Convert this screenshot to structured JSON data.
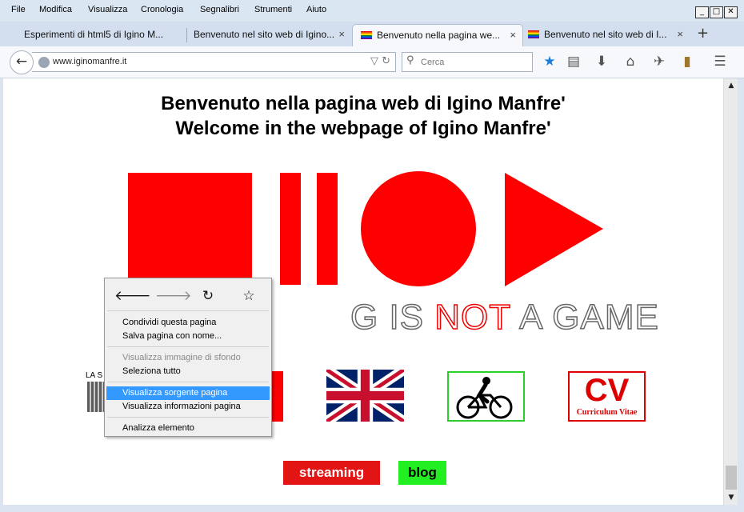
{
  "menubar": {
    "items": [
      "File",
      "Modifica",
      "Visualizza",
      "Cronologia",
      "Segnalibri",
      "Strumenti",
      "Aiuto"
    ],
    "window_buttons": {
      "minimize": "_",
      "maximize": "□",
      "close": "✕"
    }
  },
  "tabs": [
    {
      "label": "Esperimenti di html5 di Igino M...",
      "active": false,
      "has_flag": false
    },
    {
      "label": "Benvenuto nel sito web di Igino...",
      "active": false,
      "has_flag": false
    },
    {
      "label": "Benvenuto nella pagina we...",
      "active": true,
      "has_flag": true
    },
    {
      "label": "Benvenuto nel sito web di I...",
      "active": false,
      "has_flag": true
    }
  ],
  "tab_close": "×",
  "new_tab": "+",
  "navbar": {
    "back_icon": "←",
    "url": "www.iginomanfre.it",
    "url_dropdown": "▽",
    "reload": "↻",
    "search_icon": "🔍",
    "search_placeholder": "Cerca",
    "toolbar_icons": [
      "★",
      "▤",
      "⬇",
      "⌂",
      "✈",
      "▮",
      "☰"
    ]
  },
  "page": {
    "title_it": "Benvenuto nella pagina web di Igino Manfre'",
    "title_en": "Welcome in the webpage of Igino Manfre'",
    "tagline_visible_start": "G IS ",
    "tagline_red": "NOT",
    "tagline_end": " A GAME",
    "cv_big": "CV",
    "cv_small": "Curriculum Vitae",
    "lasx_text": "LA S",
    "streaming_label": "streaming",
    "blog_label": "blog",
    "colors": {
      "accent_red": "#ff0000",
      "green": "#22ee22"
    }
  },
  "context_menu": {
    "nav_icons": [
      "🡐",
      "🡒",
      "↻",
      "☆"
    ],
    "items_group1": [
      "Condividi questa pagina",
      "Salva pagina con nome..."
    ],
    "items_group2": [
      {
        "label": "Visualizza immagine di sfondo",
        "disabled": true
      },
      {
        "label": "Seleziona tutto",
        "disabled": false
      }
    ],
    "items_group3": [
      {
        "label": "Visualizza sorgente pagina",
        "highlighted": true
      },
      {
        "label": "Visualizza informazioni pagina",
        "highlighted": false
      }
    ],
    "items_group4": [
      "Analizza elemento"
    ]
  }
}
